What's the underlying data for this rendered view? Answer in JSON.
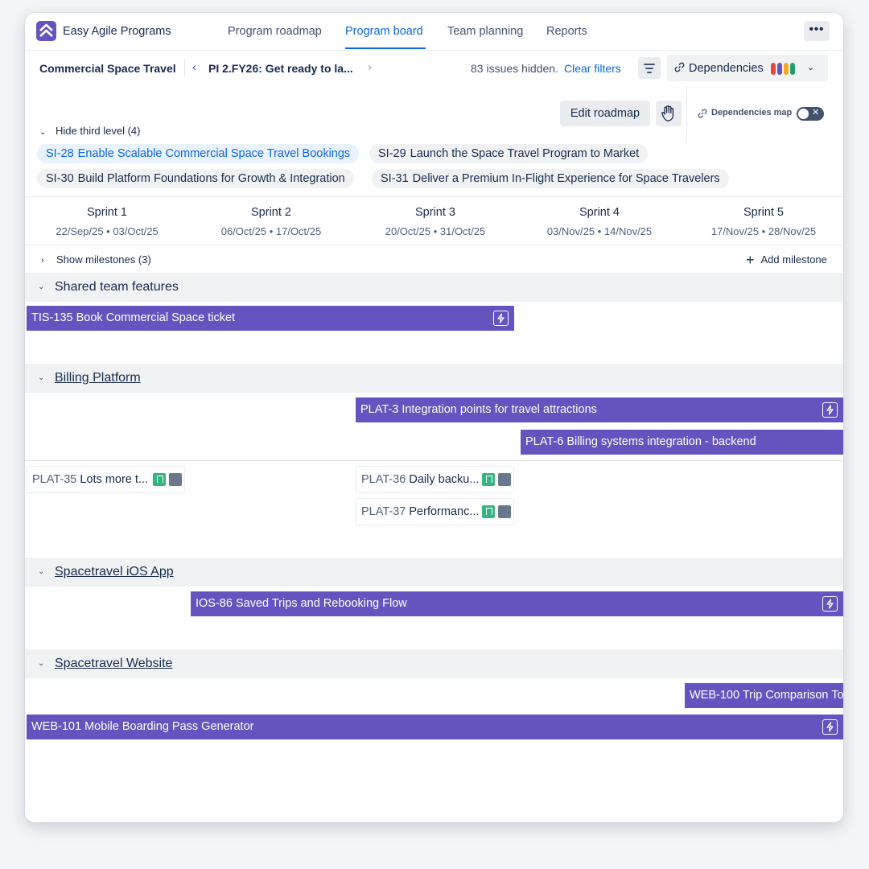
{
  "app": {
    "name": "Easy Agile Programs",
    "tabs": [
      {
        "label": "Program roadmap"
      },
      {
        "label": "Program board"
      },
      {
        "label": "Team planning"
      },
      {
        "label": "Reports"
      }
    ],
    "more_label": "•••"
  },
  "breadcrumb": {
    "program": "Commercial Space Travel",
    "prev_icon": "‹",
    "pi": "PI 2.FY26: Get ready to la...",
    "next_icon": "›",
    "hidden_issues": "83 issues hidden.",
    "clear_filters": "Clear filters",
    "dependencies_label": "Dependencies",
    "dependency_colors": [
      "#e34935",
      "#6554c0",
      "#f5a623",
      "#22a06b"
    ]
  },
  "toolbar": {
    "edit_roadmap": "Edit roadmap",
    "dependencies_map": "Dependencies map",
    "toggle_state": "off"
  },
  "third_level": {
    "hide_label": "Hide third level (4)",
    "chips": [
      {
        "key": "SI-28",
        "title": "Enable Scalable Commercial Space Travel Bookings",
        "selected": true
      },
      {
        "key": "SI-29",
        "title": "Launch the Space Travel Program to Market",
        "selected": false
      },
      {
        "key": "SI-30",
        "title": "Build Platform Foundations for Growth & Integration",
        "selected": false
      },
      {
        "key": "SI-31",
        "title": "Deliver a Premium In-Flight Experience for Space Travelers",
        "selected": false
      }
    ]
  },
  "sprints": [
    {
      "name": "Sprint 1",
      "dates": "22/Sep/25 • 03/Oct/25"
    },
    {
      "name": "Sprint 2",
      "dates": "06/Oct/25 • 17/Oct/25"
    },
    {
      "name": "Sprint 3",
      "dates": "20/Oct/25 • 31/Oct/25"
    },
    {
      "name": "Sprint 4",
      "dates": "03/Nov/25 • 14/Nov/25"
    },
    {
      "name": "Sprint 5",
      "dates": "17/Nov/25 • 28/Nov/25"
    }
  ],
  "milestones": {
    "show_label": "Show milestones (3)",
    "add_label": "Add milestone"
  },
  "lanes": {
    "shared": {
      "title": "Shared team features",
      "features": [
        {
          "key": "TIS-135",
          "title": "Book Commercial Space ticket"
        }
      ]
    },
    "billing": {
      "title": "Billing Platform",
      "features": [
        {
          "key": "PLAT-3",
          "title": "Integration points for travel attractions"
        },
        {
          "key": "PLAT-6",
          "title": "Billing systems integration - backend"
        }
      ],
      "stories": [
        {
          "key": "PLAT-35",
          "title": "Lots more t..."
        },
        {
          "key": "PLAT-36",
          "title": "Daily backu..."
        },
        {
          "key": "PLAT-37",
          "title": "Performanc..."
        }
      ]
    },
    "ios": {
      "title": "Spacetravel iOS App",
      "features": [
        {
          "key": "IOS-86",
          "title": "Saved Trips and Rebooking Flow"
        }
      ]
    },
    "web": {
      "title": "Spacetravel Website",
      "features": [
        {
          "key": "WEB-100",
          "title": "Trip Comparison To"
        },
        {
          "key": "WEB-101",
          "title": "Mobile Boarding Pass Generator"
        }
      ]
    }
  }
}
